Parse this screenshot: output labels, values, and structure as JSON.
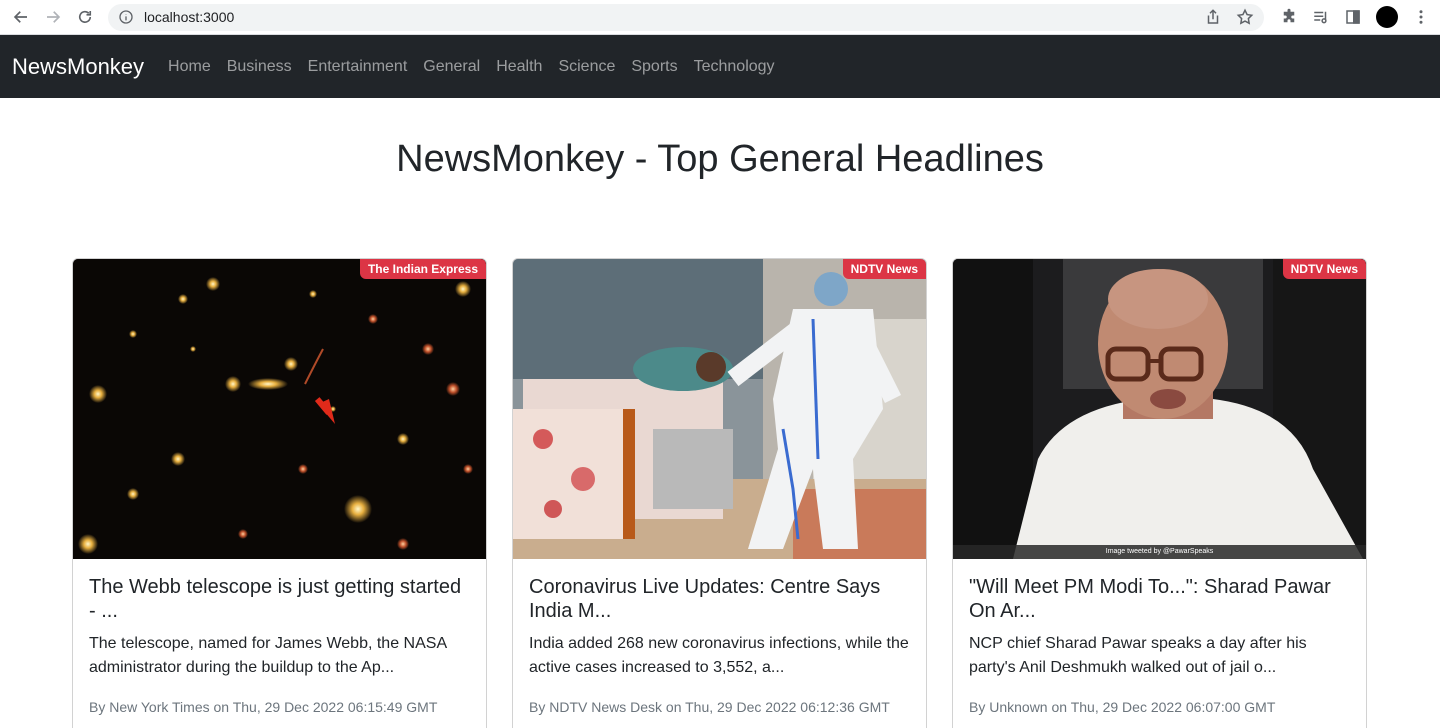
{
  "browser": {
    "url": "localhost:3000"
  },
  "navbar": {
    "brand": "NewsMonkey",
    "links": [
      "Home",
      "Business",
      "Entertainment",
      "General",
      "Health",
      "Science",
      "Sports",
      "Technology"
    ]
  },
  "page_title": "NewsMonkey - Top General Headlines",
  "cards": [
    {
      "source": "The Indian Express",
      "title": "The Webb telescope is just getting started - ...",
      "description": "The telescope, named for James Webb, the NASA administrator during the buildup to the Ap...",
      "meta": "By New York Times on Thu, 29 Dec 2022 06:15:49 GMT"
    },
    {
      "source": "NDTV News",
      "title": "Coronavirus Live Updates: Centre Says India M...",
      "description": "India added 268 new coronavirus infections, while the active cases increased to 3,552, a...",
      "meta": "By NDTV News Desk on Thu, 29 Dec 2022 06:12:36 GMT"
    },
    {
      "source": "NDTV News",
      "title": "\"Will Meet PM Modi To...\": Sharad Pawar On Ar...",
      "description": "NCP chief Sharad Pawar speaks a day after his party's Anil Deshmukh walked out of jail o...",
      "meta": "By Unknown on Thu, 29 Dec 2022 06:07:00 GMT",
      "image_caption": "Image tweeted by @PawarSpeaks"
    }
  ],
  "colors": {
    "navbar_bg": "#212529",
    "badge_bg": "#dc3545"
  }
}
